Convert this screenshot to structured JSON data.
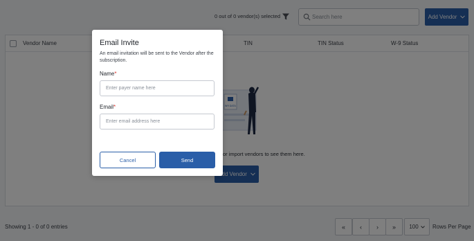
{
  "toolbar": {
    "selection_count": "0 out of 0 vendor(s) selected",
    "search_placeholder": "Search here",
    "add_vendor_label": "Add Vendor"
  },
  "table": {
    "columns": [
      "Vendor Name",
      "TIN",
      "TIN Status",
      "W-9 Status"
    ]
  },
  "empty_state": {
    "text": "or import vendors to see them here.",
    "add_vendor_label": "Add Vendor",
    "illustration_caption": "W9 DATA"
  },
  "footer": {
    "showing_text": "Showing 1 - 0 of 0 entries",
    "pager": {
      "first": "«",
      "prev": "‹",
      "next": "›",
      "last": "»"
    },
    "per_page_value": "100",
    "per_page_label": "Rows Per Page"
  },
  "modal": {
    "title": "Email Invite",
    "description": "An email invitation will be sent to the Vendor after the subscription.",
    "name_label": "Name",
    "name_placeholder": "Enter payer name here",
    "email_label": "Email",
    "email_placeholder": "Enter email address here",
    "required_marker": "*",
    "cancel_label": "Cancel",
    "send_label": "Send"
  },
  "colors": {
    "primary": "#2a5ea8",
    "required": "#d9352e",
    "overlay": "rgba(0,0,0,0.5)"
  },
  "icons": {
    "filter": "filter-icon",
    "search": "search-icon",
    "dropdown": "chevron-down-icon"
  }
}
